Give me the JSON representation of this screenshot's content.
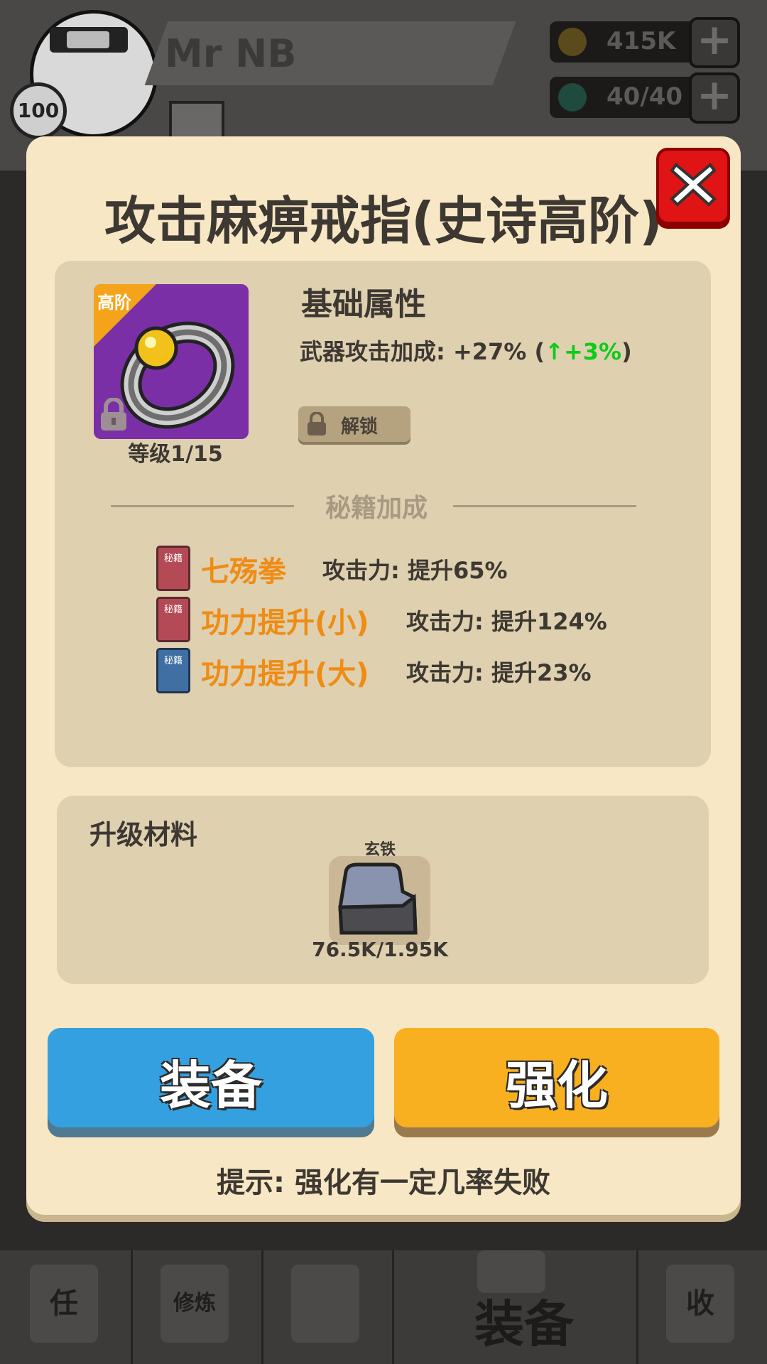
{
  "hud": {
    "player_name": "Mr NB",
    "player_level": "100",
    "gold": "415K",
    "energy": "40/40",
    "plus": "+"
  },
  "bottom_nav": {
    "tab_task": "任",
    "tab_train": "修炼",
    "tab_equip_label": "装备",
    "tab_collect": "收"
  },
  "modal": {
    "title": "攻击麻痹戒指(史诗高阶)",
    "item": {
      "tier_tag": "高阶",
      "level": "等级1/15",
      "icon": "ring-icon"
    },
    "base": {
      "title": "基础属性",
      "stat_label": "武器攻击加成: +27% (",
      "stat_bonus": "↑+3%",
      "stat_close": ")"
    },
    "unlock_label": "解锁",
    "secret": {
      "title": "秘籍加成",
      "items": [
        {
          "book_label": "秘籍",
          "name": "七殇拳",
          "effect": "攻击力: 提升65%",
          "book_color": "#b34a55"
        },
        {
          "book_label": "秘籍",
          "name": "功力提升(小)",
          "effect": "攻击力: 提升124%",
          "book_color": "#b34a55"
        },
        {
          "book_label": "秘籍",
          "name": "功力提升(大)",
          "effect": "攻击力: 提升23%",
          "book_color": "#3f6fa3"
        }
      ]
    },
    "materials": {
      "title": "升级材料",
      "item_name": "玄铁",
      "count": "76.5K/1.95K"
    },
    "buttons": {
      "equip": "装备",
      "enhance": "强化"
    },
    "hint": "提示: 强化有一定几率失败"
  },
  "colors": {
    "modal_bg": "#f8e7c5",
    "panel_bg": "#dfd0b0",
    "equip_btn": "#35a0e0",
    "enhance_btn": "#f8b020",
    "skill_name": "#ef8c14",
    "bonus_green": "#0ecb1a",
    "close_red": "#e01414"
  }
}
